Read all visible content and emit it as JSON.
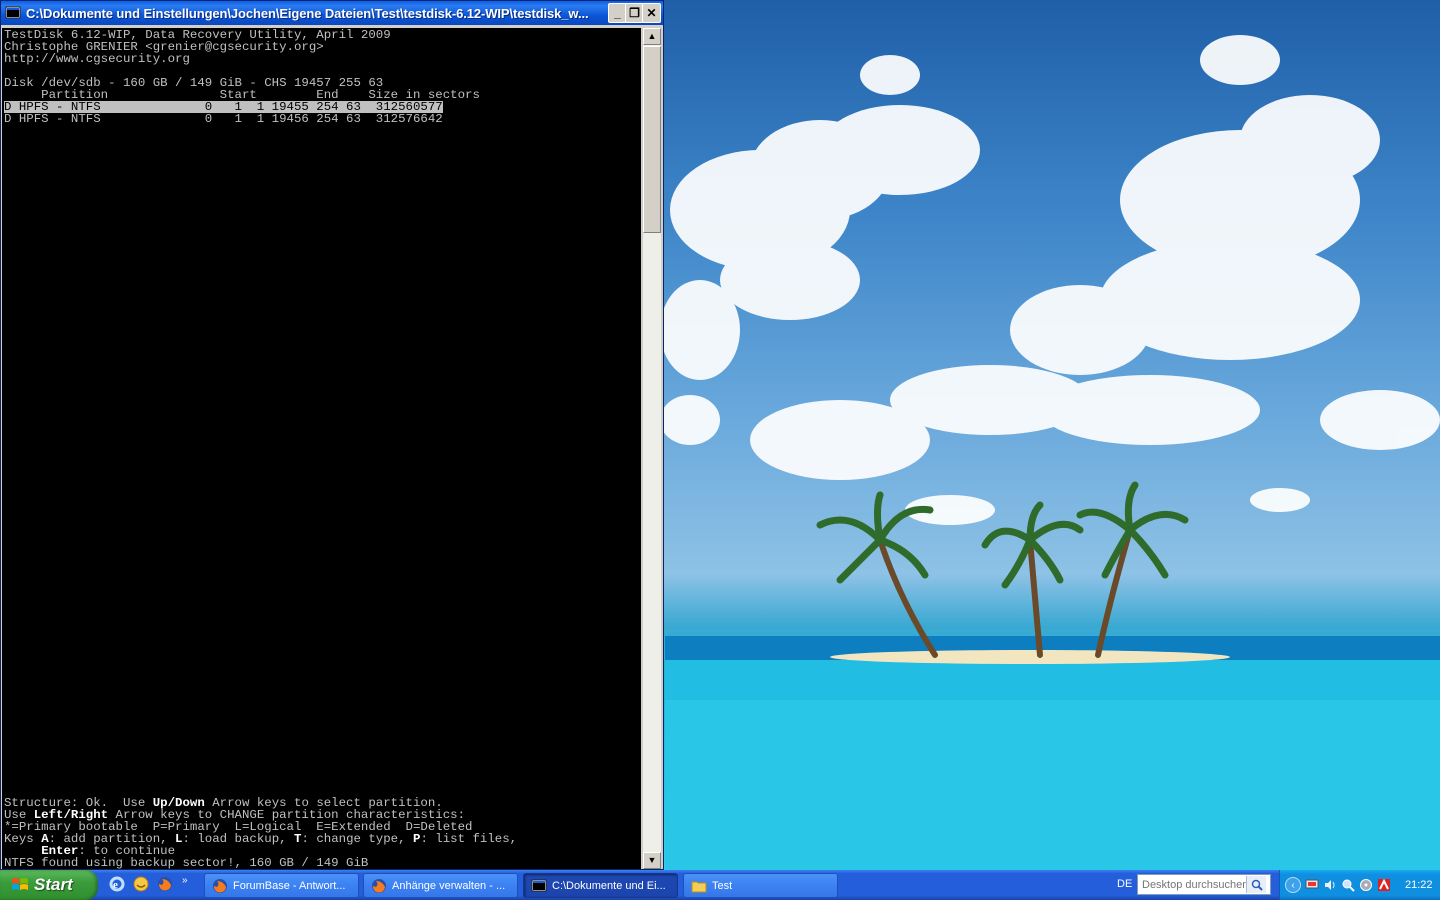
{
  "window": {
    "title": "C:\\Dokumente und Einstellungen\\Jochen\\Eigene Dateien\\Test\\testdisk-6.12-WIP\\testdisk_w...",
    "buttons": {
      "minimize": "_",
      "restore": "❐",
      "close": "✕"
    }
  },
  "console": {
    "header": [
      "TestDisk 6.12-WIP, Data Recovery Utility, April 2009",
      "Christophe GRENIER <grenier@cgsecurity.org>",
      "http://www.cgsecurity.org",
      "",
      "Disk /dev/sdb - 160 GB / 149 GiB - CHS 19457 255 63",
      "     Partition               Start        End    Size in sectors"
    ],
    "partitions": [
      "D HPFS - NTFS              0   1  1 19455 254 63  312560577",
      "D HPFS - NTFS              0   1  1 19456 254 63  312576642"
    ],
    "footer": {
      "l1_a": "Structure: Ok.  Use ",
      "l1_b": "Up/Down",
      "l1_c": " Arrow keys to select partition.",
      "l2_a": "Use ",
      "l2_b": "Left/Right",
      "l2_c": " Arrow keys to CHANGE partition characteristics:",
      "l3": "*=Primary bootable  P=Primary  L=Logical  E=Extended  D=Deleted",
      "l4_a": "Keys ",
      "l4_b": "A",
      "l4_c": ": add partition, ",
      "l4_d": "L",
      "l4_e": ": load backup, ",
      "l4_f": "T",
      "l4_g": ": change type, ",
      "l4_h": "P",
      "l4_i": ": list files,",
      "l5_a": "     ",
      "l5_b": "Enter",
      "l5_c": ": to continue",
      "l6": "NTFS found using backup sector!, 160 GB / 149 GiB"
    }
  },
  "taskbar": {
    "start_label": "Start",
    "quick_more": "»",
    "tasks": [
      {
        "label": "ForumBase - Antwort...",
        "icon": "firefox-icon"
      },
      {
        "label": "Anhänge verwalten - ...",
        "icon": "firefox-icon"
      },
      {
        "label": "C:\\Dokumente und Ei...",
        "icon": "console-icon"
      },
      {
        "label": "Test",
        "icon": "folder-icon"
      }
    ],
    "language": "DE",
    "search_placeholder": "Desktop durchsuchen",
    "tray_chevron": "‹",
    "clock": "21:22"
  }
}
